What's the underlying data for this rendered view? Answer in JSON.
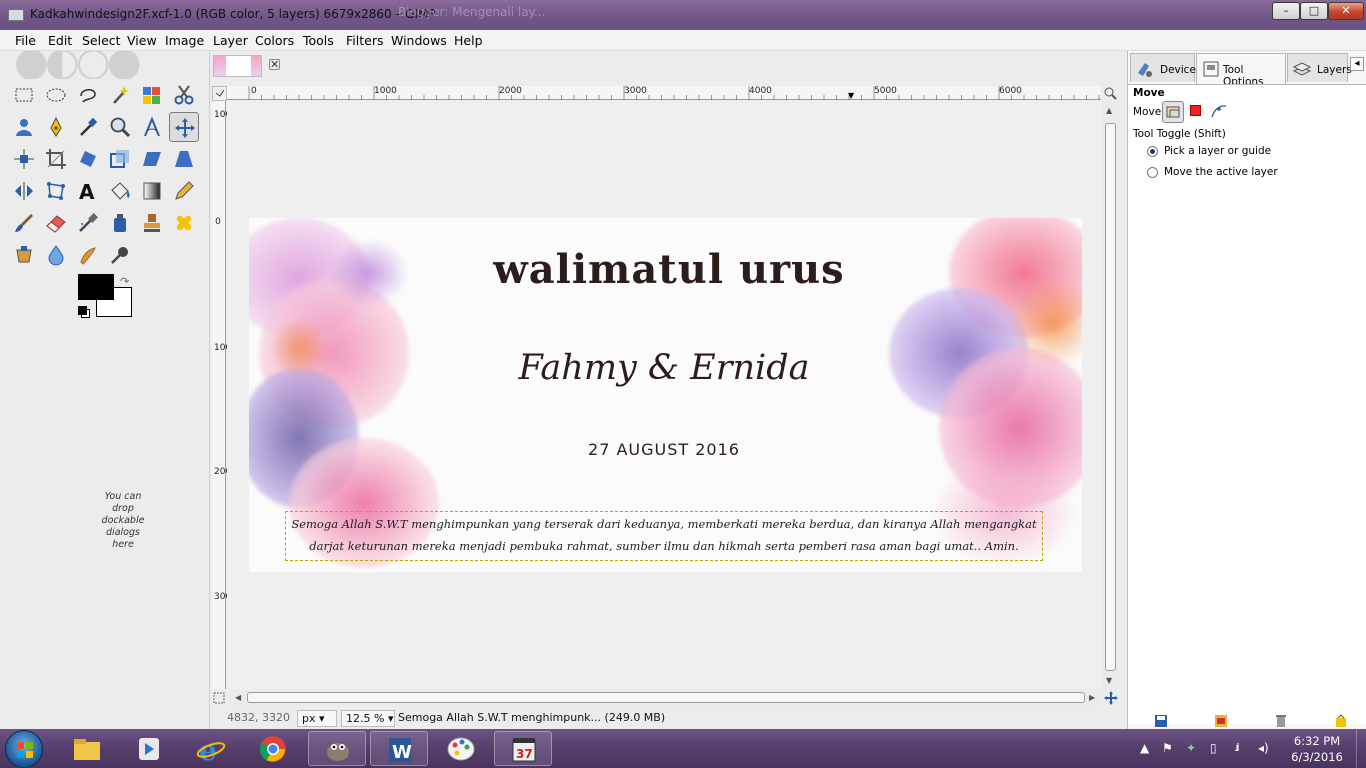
{
  "window": {
    "title": "Kadkahwindesign2F.xcf-1.0 (RGB color, 5 layers) 6679x2860 – GIMP",
    "background_tab": "Blogger: Mengenali lay..."
  },
  "menu": [
    "File",
    "Edit",
    "Select",
    "View",
    "Image",
    "Layer",
    "Colors",
    "Tools",
    "Filters",
    "Windows",
    "Help"
  ],
  "toolbox": {
    "dock_hint": "You can drop dockable dialogs here",
    "fg_color": "#000000",
    "bg_color": "#ffffff"
  },
  "rulers": {
    "horizontal": [
      "0",
      "1000",
      "2000",
      "3000",
      "4000",
      "5000",
      "6000"
    ],
    "vertical": [
      "100",
      "0",
      "1000",
      "2000",
      "3000"
    ]
  },
  "image": {
    "title": "walimatul urus",
    "names": "Fahmy & Ernida",
    "date": "27 AUGUST 2016",
    "blessing_line1": "Semoga Allah S.W.T menghimpunkan yang terserak dari keduanya, memberkati mereka berdua, dan kiranya Allah mengangkat",
    "blessing_line2": "darjat keturunan mereka menjadi pembuka rahmat, sumber ilmu dan hikmah serta pemberi rasa aman bagi umat.. Amin."
  },
  "statusbar": {
    "coords": "4832, 3320",
    "unit": "px",
    "zoom": "12.5 %",
    "message": "Semoga Allah S.W.T menghimpunk... (249.0 MB)"
  },
  "dock": {
    "tabs": [
      "Devices",
      "Tool Options",
      "Layers"
    ],
    "tool_name": "Move",
    "move_label": "Move:",
    "toggle_label": "Tool Toggle  (Shift)",
    "option_pick": "Pick a layer or guide",
    "option_move": "Move the active layer"
  },
  "taskbar": {
    "time": "6:32 PM",
    "date": "6/3/2016"
  },
  "colors": {
    "titlebar": "#6e5585",
    "taskbar": "#553e6c",
    "selection_dash": "#b7a700"
  }
}
